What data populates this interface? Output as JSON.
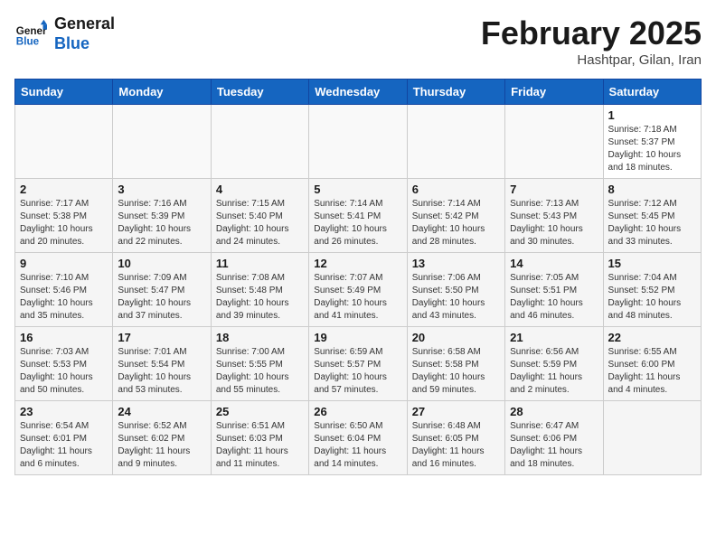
{
  "logo": {
    "line1": "General",
    "line2": "Blue"
  },
  "title": "February 2025",
  "subtitle": "Hashtpar, Gilan, Iran",
  "headers": [
    "Sunday",
    "Monday",
    "Tuesday",
    "Wednesday",
    "Thursday",
    "Friday",
    "Saturday"
  ],
  "weeks": [
    [
      {
        "day": "",
        "info": ""
      },
      {
        "day": "",
        "info": ""
      },
      {
        "day": "",
        "info": ""
      },
      {
        "day": "",
        "info": ""
      },
      {
        "day": "",
        "info": ""
      },
      {
        "day": "",
        "info": ""
      },
      {
        "day": "1",
        "info": "Sunrise: 7:18 AM\nSunset: 5:37 PM\nDaylight: 10 hours\nand 18 minutes."
      }
    ],
    [
      {
        "day": "2",
        "info": "Sunrise: 7:17 AM\nSunset: 5:38 PM\nDaylight: 10 hours\nand 20 minutes."
      },
      {
        "day": "3",
        "info": "Sunrise: 7:16 AM\nSunset: 5:39 PM\nDaylight: 10 hours\nand 22 minutes."
      },
      {
        "day": "4",
        "info": "Sunrise: 7:15 AM\nSunset: 5:40 PM\nDaylight: 10 hours\nand 24 minutes."
      },
      {
        "day": "5",
        "info": "Sunrise: 7:14 AM\nSunset: 5:41 PM\nDaylight: 10 hours\nand 26 minutes."
      },
      {
        "day": "6",
        "info": "Sunrise: 7:14 AM\nSunset: 5:42 PM\nDaylight: 10 hours\nand 28 minutes."
      },
      {
        "day": "7",
        "info": "Sunrise: 7:13 AM\nSunset: 5:43 PM\nDaylight: 10 hours\nand 30 minutes."
      },
      {
        "day": "8",
        "info": "Sunrise: 7:12 AM\nSunset: 5:45 PM\nDaylight: 10 hours\nand 33 minutes."
      }
    ],
    [
      {
        "day": "9",
        "info": "Sunrise: 7:10 AM\nSunset: 5:46 PM\nDaylight: 10 hours\nand 35 minutes."
      },
      {
        "day": "10",
        "info": "Sunrise: 7:09 AM\nSunset: 5:47 PM\nDaylight: 10 hours\nand 37 minutes."
      },
      {
        "day": "11",
        "info": "Sunrise: 7:08 AM\nSunset: 5:48 PM\nDaylight: 10 hours\nand 39 minutes."
      },
      {
        "day": "12",
        "info": "Sunrise: 7:07 AM\nSunset: 5:49 PM\nDaylight: 10 hours\nand 41 minutes."
      },
      {
        "day": "13",
        "info": "Sunrise: 7:06 AM\nSunset: 5:50 PM\nDaylight: 10 hours\nand 43 minutes."
      },
      {
        "day": "14",
        "info": "Sunrise: 7:05 AM\nSunset: 5:51 PM\nDaylight: 10 hours\nand 46 minutes."
      },
      {
        "day": "15",
        "info": "Sunrise: 7:04 AM\nSunset: 5:52 PM\nDaylight: 10 hours\nand 48 minutes."
      }
    ],
    [
      {
        "day": "16",
        "info": "Sunrise: 7:03 AM\nSunset: 5:53 PM\nDaylight: 10 hours\nand 50 minutes."
      },
      {
        "day": "17",
        "info": "Sunrise: 7:01 AM\nSunset: 5:54 PM\nDaylight: 10 hours\nand 53 minutes."
      },
      {
        "day": "18",
        "info": "Sunrise: 7:00 AM\nSunset: 5:55 PM\nDaylight: 10 hours\nand 55 minutes."
      },
      {
        "day": "19",
        "info": "Sunrise: 6:59 AM\nSunset: 5:57 PM\nDaylight: 10 hours\nand 57 minutes."
      },
      {
        "day": "20",
        "info": "Sunrise: 6:58 AM\nSunset: 5:58 PM\nDaylight: 10 hours\nand 59 minutes."
      },
      {
        "day": "21",
        "info": "Sunrise: 6:56 AM\nSunset: 5:59 PM\nDaylight: 11 hours\nand 2 minutes."
      },
      {
        "day": "22",
        "info": "Sunrise: 6:55 AM\nSunset: 6:00 PM\nDaylight: 11 hours\nand 4 minutes."
      }
    ],
    [
      {
        "day": "23",
        "info": "Sunrise: 6:54 AM\nSunset: 6:01 PM\nDaylight: 11 hours\nand 6 minutes."
      },
      {
        "day": "24",
        "info": "Sunrise: 6:52 AM\nSunset: 6:02 PM\nDaylight: 11 hours\nand 9 minutes."
      },
      {
        "day": "25",
        "info": "Sunrise: 6:51 AM\nSunset: 6:03 PM\nDaylight: 11 hours\nand 11 minutes."
      },
      {
        "day": "26",
        "info": "Sunrise: 6:50 AM\nSunset: 6:04 PM\nDaylight: 11 hours\nand 14 minutes."
      },
      {
        "day": "27",
        "info": "Sunrise: 6:48 AM\nSunset: 6:05 PM\nDaylight: 11 hours\nand 16 minutes."
      },
      {
        "day": "28",
        "info": "Sunrise: 6:47 AM\nSunset: 6:06 PM\nDaylight: 11 hours\nand 18 minutes."
      },
      {
        "day": "",
        "info": ""
      }
    ]
  ]
}
